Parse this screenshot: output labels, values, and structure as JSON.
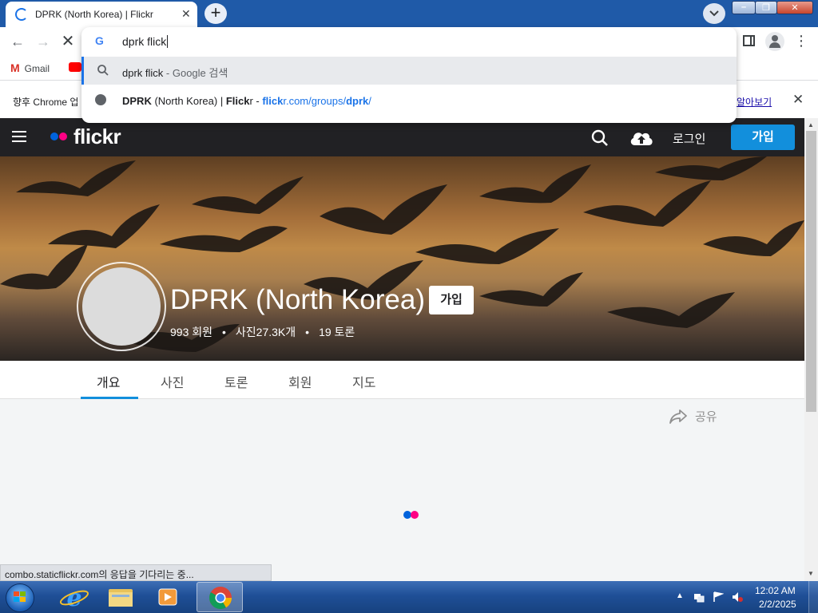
{
  "browser": {
    "tab_title": "DPRK (North Korea) | Flickr",
    "tab_close": "✕",
    "new_tab": "+",
    "back": "←",
    "forward": "→",
    "stop": "✕",
    "menu": "⋮"
  },
  "bookmarks": {
    "gmail_label": "Gmail"
  },
  "infobar": {
    "text": "향후 Chrome 업",
    "link": "알아보기",
    "close": "✕"
  },
  "omnibox": {
    "g_logo": "G",
    "input_value": "dprk flick",
    "suggestion1_query": "dprk flick",
    "suggestion1_suffix": " - Google 검색",
    "suggestion2_title_bold": "DPRK",
    "suggestion2_title_rest": " (North Korea) | ",
    "suggestion2_title_bold2": "Flick",
    "suggestion2_title_rest2": "r - ",
    "suggestion2_url_pre": "flick",
    "suggestion2_url_mid": "r.com/groups/",
    "suggestion2_url_bold": "dprk",
    "suggestion2_url_end": "/"
  },
  "flickr": {
    "logo_text": "flickr",
    "login": "로그인",
    "signup": "가입",
    "group": {
      "name": "DPRK (North Korea)",
      "join": "가입",
      "members": "993 회원",
      "photos": "사진27.3K개",
      "discussions": "19 토론",
      "separator": "•"
    },
    "tabs": {
      "overview": "개요",
      "photos": "사진",
      "discussions": "토론",
      "members": "회원",
      "map": "지도"
    },
    "share": "공유"
  },
  "status_bar": "combo.staticflickr.com의 응답을 기다리는 중...",
  "taskbar": {
    "time": "12:02 AM",
    "date": "2/2/2025"
  },
  "colors": {
    "flickr_blue": "#0063dc",
    "flickr_pink": "#ff0084",
    "signup_blue": "#128fdc",
    "nav_dark": "#212124"
  }
}
